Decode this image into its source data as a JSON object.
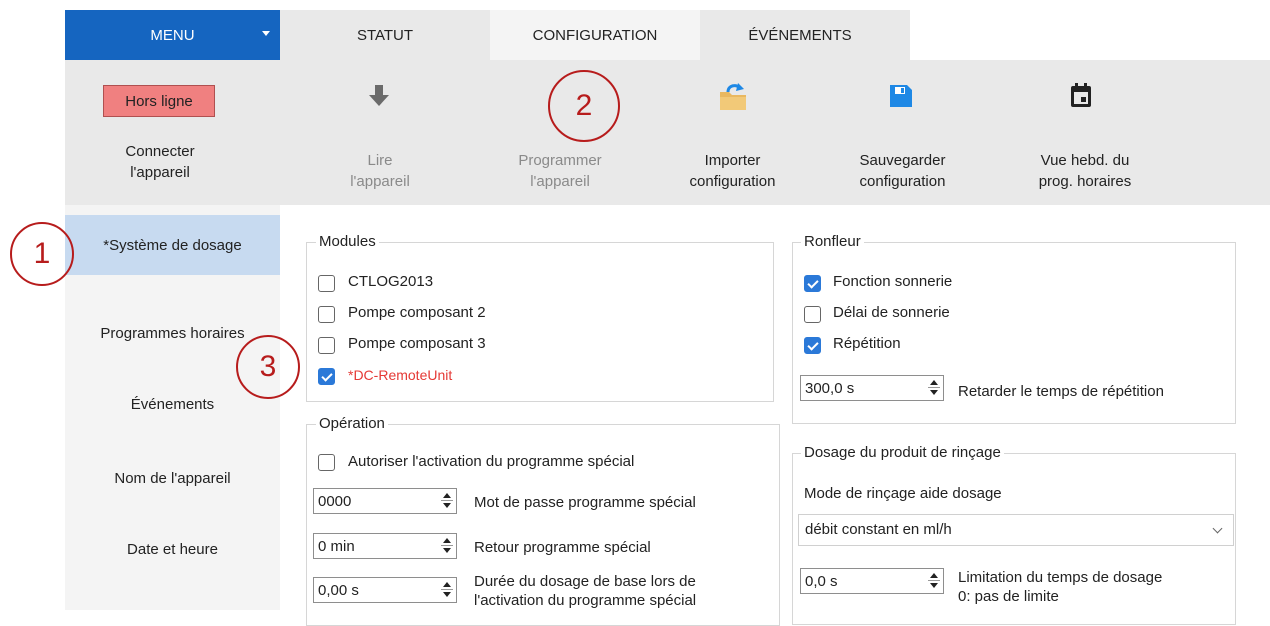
{
  "tabs": {
    "menu": "MENU",
    "statut": "STATUT",
    "configuration": "CONFIGURATION",
    "evenements": "ÉVÉNEMENTS"
  },
  "toolbar": {
    "offline_button": "Hors ligne",
    "connect_label_1": "Connecter",
    "connect_label_2": "l'appareil",
    "read_label_1": "Lire",
    "read_label_2": "l'appareil",
    "program_label_1": "Programmer",
    "program_label_2": "l'appareil",
    "import_label_1": "Importer",
    "import_label_2": "configuration",
    "save_label_1": "Sauvegarder",
    "save_label_2": "configuration",
    "weekly_label_1": "Vue hebd. du",
    "weekly_label_2": "prog. horaires"
  },
  "sidebar": {
    "items": [
      "*Système de dosage",
      "Programmes horaires",
      "Événements",
      "Nom de l'appareil",
      "Date et heure"
    ]
  },
  "modules": {
    "legend": "Modules",
    "items": [
      {
        "label": "CTLOG2013",
        "checked": false
      },
      {
        "label": "Pompe composant 2",
        "checked": false
      },
      {
        "label": "Pompe composant 3",
        "checked": false
      },
      {
        "label": "*DC-RemoteUnit",
        "checked": true
      }
    ]
  },
  "operation": {
    "legend": "Opération",
    "allow_special": "Autoriser l'activation du programme spécial",
    "password_value": "0000",
    "password_label": "Mot de passe programme spécial",
    "return_value": "0 min",
    "return_label": "Retour programme spécial",
    "base_value": "0,00 s",
    "base_label_1": "Durée du dosage de base lors de",
    "base_label_2": "l'activation du programme spécial"
  },
  "ronfleur": {
    "legend": "Ronfleur",
    "items": [
      {
        "label": "Fonction sonnerie",
        "checked": true
      },
      {
        "label": "Délai de sonnerie",
        "checked": false
      },
      {
        "label": "Répétition",
        "checked": true
      }
    ],
    "delay_value": "300,0 s",
    "delay_label": "Retarder le temps de répétition"
  },
  "rincage": {
    "legend": "Dosage du produit de rinçage",
    "mode_label": "Mode de rinçage aide dosage",
    "mode_value": "débit constant en ml/h",
    "limit_value": "0,0 s",
    "limit_label_1": "Limitation du temps de dosage",
    "limit_label_2": "0: pas de limite"
  },
  "annotations": [
    "1",
    "2",
    "3"
  ],
  "colors": {
    "menu_blue": "#1565c0",
    "selected_blue": "#c7daf0",
    "checkbox_blue": "#2b79d8",
    "offline_red": "#f08080",
    "annotation_red": "#b71c1c",
    "warning_red": "#e53935"
  }
}
